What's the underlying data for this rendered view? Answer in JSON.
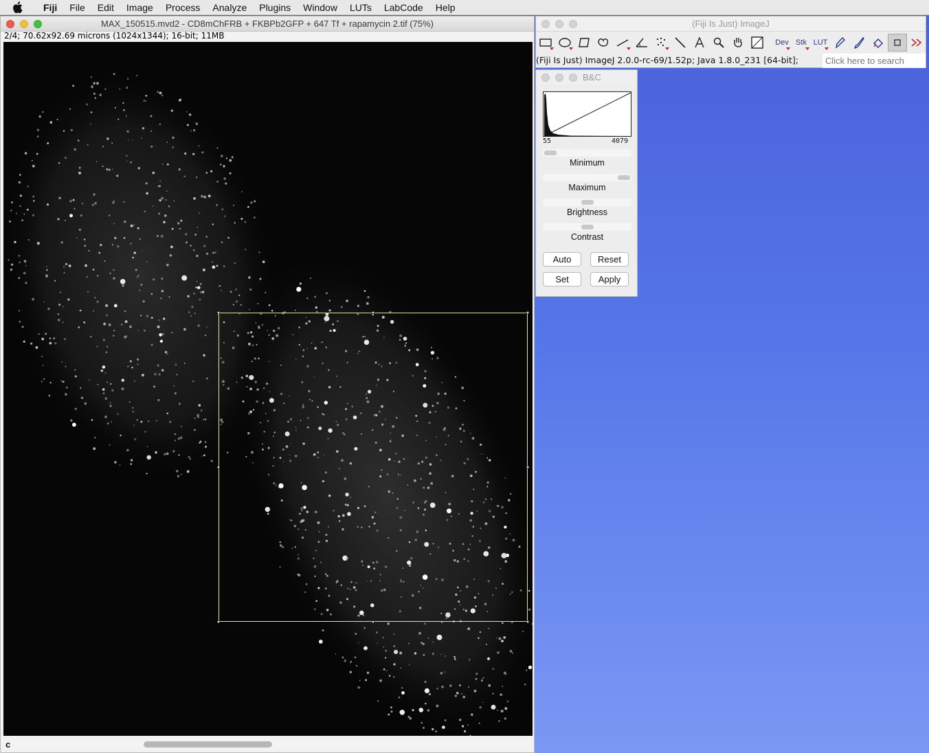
{
  "menubar": {
    "app": "Fiji",
    "items": [
      "File",
      "Edit",
      "Image",
      "Process",
      "Analyze",
      "Plugins",
      "Window",
      "LUTs",
      "LabCode",
      "Help"
    ]
  },
  "image_window": {
    "title": "MAX_150515.mvd2 - CD8mChFRB + FKBPb2GFP + 647 Tf + rapamycin 2.tif (75%)",
    "info": "2/4; 70.62x92.69 microns (1024x1344); 16-bit; 11MB",
    "channel": "c"
  },
  "imagej_window": {
    "title": "(Fiji Is Just) ImageJ",
    "status": "(Fiji Is Just) ImageJ 2.0.0-rc-69/1.52p; Java 1.8.0_231 [64-bit];",
    "search_placeholder": "Click here to search",
    "tools": [
      "rectangle-tool",
      "oval-tool",
      "polygon-tool",
      "freehand-tool",
      "line-tool",
      "angle-tool",
      "point-tool",
      "wand-tool",
      "text-tool",
      "magnifier-tool",
      "hand-tool",
      "color-picker-tool",
      "dev-tool",
      "stk-tool",
      "lut-tool",
      "pencil-tool",
      "brush-tool",
      "flood-fill-tool",
      "overlay-tool",
      "more-tools"
    ],
    "text_tools": {
      "dev": "Dev",
      "stk": "Stk",
      "lut": "LUT"
    }
  },
  "bc_window": {
    "title": "B&C",
    "hist_min": "55",
    "hist_max": "4079",
    "sliders": {
      "minimum": {
        "label": "Minimum",
        "value": 0.0
      },
      "maximum": {
        "label": "Maximum",
        "value": 1.0
      },
      "brightness": {
        "label": "Brightness",
        "value": 0.5
      },
      "contrast": {
        "label": "Contrast",
        "value": 0.5
      }
    },
    "buttons": {
      "auto": "Auto",
      "reset": "Reset",
      "set": "Set",
      "apply": "Apply"
    }
  }
}
